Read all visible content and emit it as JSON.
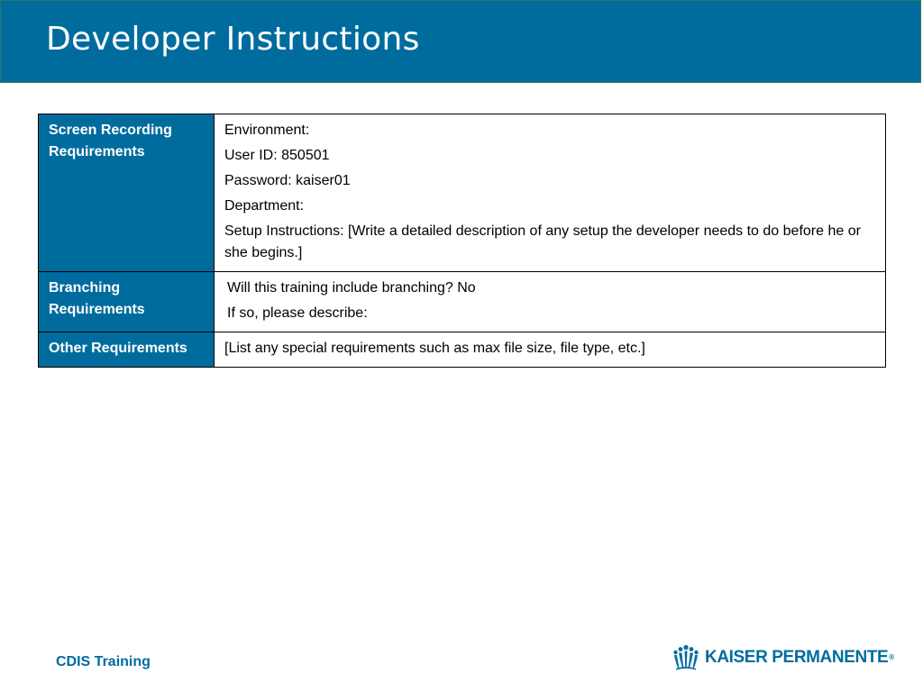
{
  "slide": {
    "title": "Developer Instructions"
  },
  "table": {
    "rows": [
      {
        "heading": "Screen Recording Requirements",
        "lines": [
          "Environment:",
          "User ID: 850501",
          "Password: kaiser01",
          "Department:",
          "Setup Instructions: [Write a detailed description of any setup the developer needs to do before he or she begins.]"
        ]
      },
      {
        "heading": "Branching Requirements",
        "lines": [
          "Will this training include branching? No",
          "If so, please describe:"
        ]
      },
      {
        "heading": "Other Requirements",
        "lines": [
          "[List any special requirements such as max file size, file type, etc.]"
        ]
      }
    ]
  },
  "footer": {
    "label": "CDIS Training",
    "logo_text": "KAISER PERMANENTE",
    "logo_mark": "®"
  },
  "colors": {
    "brand_blue": "#006c9e",
    "border": "#000000"
  },
  "icons": {
    "logo": "kaiser-permanente-logo-icon"
  }
}
